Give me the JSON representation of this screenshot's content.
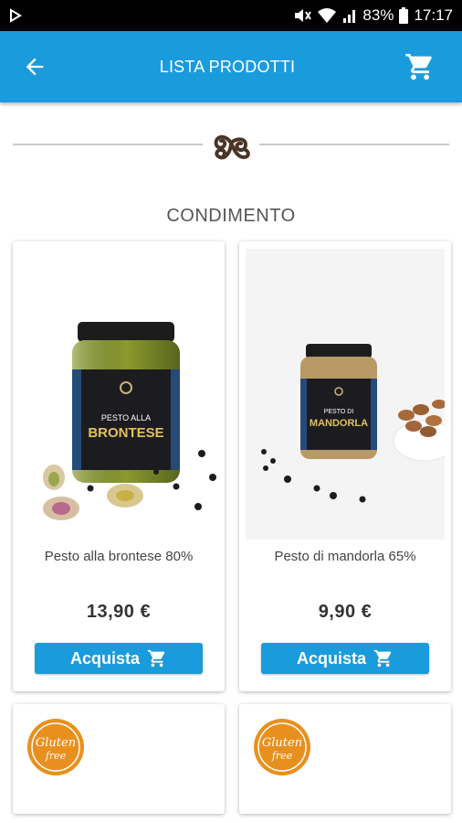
{
  "status_bar": {
    "battery": "83%",
    "time": "17:17"
  },
  "app_bar": {
    "title": "LISTA PRODOTTI",
    "back_icon": "arrow-back-icon",
    "cart_icon": "cart-icon"
  },
  "category": "CONDIMENTO",
  "products": [
    {
      "name": "Pesto alla brontese 80%",
      "price": "13,90 €",
      "button_label": "Acquista",
      "label_line1": "PESTO ALLA",
      "label_line2": "BRONTESE",
      "jar_color": "#8a9a2e"
    },
    {
      "name": "Pesto di mandorla 65%",
      "price": "9,90 €",
      "button_label": "Acquista",
      "label_line1": "PESTO DI",
      "label_line2": "MANDORLA",
      "jar_color": "#b89a66"
    }
  ],
  "badge_text_1": "Gluten",
  "badge_text_2": "free",
  "colors": {
    "primary": "#1a9bdc",
    "badge": "#e8901e"
  }
}
